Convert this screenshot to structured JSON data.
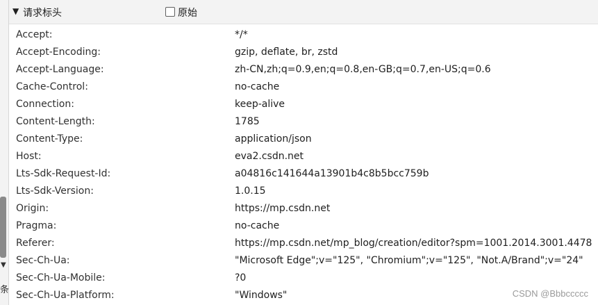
{
  "section": {
    "toggle_glyph": "▼",
    "title": "请求标头",
    "raw_label": "原始"
  },
  "headers": [
    {
      "name": "Accept:",
      "value": "*/*"
    },
    {
      "name": "Accept-Encoding:",
      "value": "gzip, deflate, br, zstd"
    },
    {
      "name": "Accept-Language:",
      "value": "zh-CN,zh;q=0.9,en;q=0.8,en-GB;q=0.7,en-US;q=0.6"
    },
    {
      "name": "Cache-Control:",
      "value": "no-cache"
    },
    {
      "name": "Connection:",
      "value": "keep-alive"
    },
    {
      "name": "Content-Length:",
      "value": "1785"
    },
    {
      "name": "Content-Type:",
      "value": "application/json"
    },
    {
      "name": "Host:",
      "value": "eva2.csdn.net"
    },
    {
      "name": "Lts-Sdk-Request-Id:",
      "value": "a04816c141644a13901b4c8b5bcc759b"
    },
    {
      "name": "Lts-Sdk-Version:",
      "value": "1.0.15"
    },
    {
      "name": "Origin:",
      "value": "https://mp.csdn.net"
    },
    {
      "name": "Pragma:",
      "value": "no-cache"
    },
    {
      "name": "Referer:",
      "value": "https://mp.csdn.net/mp_blog/creation/editor?spm=1001.2014.3001.4478"
    },
    {
      "name": "Sec-Ch-Ua:",
      "value": "\"Microsoft Edge\";v=\"125\", \"Chromium\";v=\"125\", \"Not.A/Brand\";v=\"24\""
    },
    {
      "name": "Sec-Ch-Ua-Mobile:",
      "value": "?0"
    },
    {
      "name": "Sec-Ch-Ua-Platform:",
      "value": "\"Windows\""
    }
  ],
  "side": {
    "caret": "▼",
    "glyph": "条"
  },
  "watermark": "CSDN @Bbbccccc"
}
